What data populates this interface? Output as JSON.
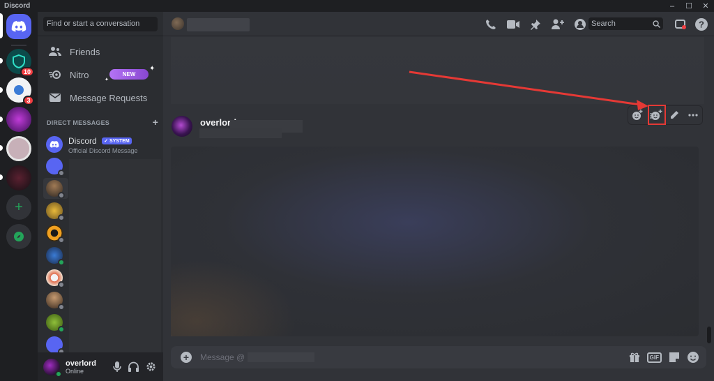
{
  "window": {
    "title": "Discord",
    "controls": [
      "–",
      "☐",
      "✕"
    ]
  },
  "servers": {
    "badges": [
      "10",
      "3"
    ]
  },
  "dm_sidebar": {
    "search_placeholder": "Find or start a conversation",
    "nav": {
      "friends": "Friends",
      "nitro": "Nitro",
      "nitro_badge": "NEW",
      "message_requests": "Message Requests"
    },
    "section_header": "DIRECT MESSAGES",
    "add_dm": "+",
    "system_dm": {
      "name": "Discord",
      "tag": "✓ SYSTEM",
      "subtitle": "Official Discord Message"
    }
  },
  "user_panel": {
    "username": "overlord",
    "status": "Online"
  },
  "topbar": {
    "search_placeholder": "Search"
  },
  "message": {
    "author": "overlord"
  },
  "composer": {
    "placeholder": "Message @",
    "gif_label": "GIF"
  },
  "colors": {
    "blurple": "#5865f2",
    "green": "#23a55a",
    "red": "#f23f43",
    "annotation_red": "#e53935"
  }
}
